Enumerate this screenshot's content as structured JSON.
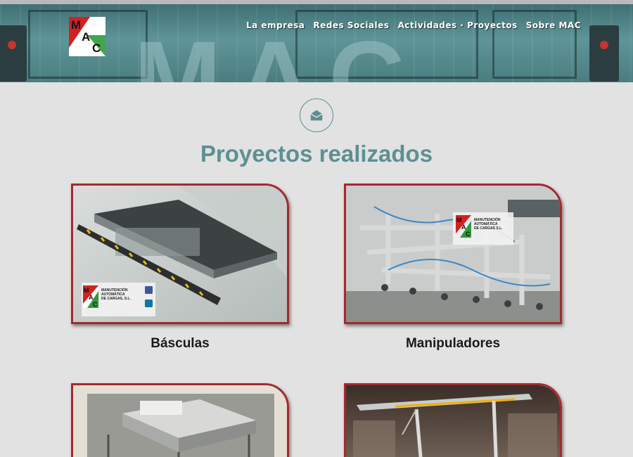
{
  "header": {
    "logo_letters": [
      "M",
      "A",
      "C"
    ],
    "background_text": "MAC",
    "nav": [
      {
        "label": "La empresa"
      },
      {
        "label": "Redes Sociales"
      },
      {
        "label": "Actividades · Proyectos"
      },
      {
        "label": "Sobre MAC"
      }
    ]
  },
  "section": {
    "icon": "envelope-open-icon",
    "title": "Proyectos realizados"
  },
  "projects": [
    {
      "label": "Básculas",
      "image": "platform-scale-photo",
      "logo_text": [
        "MANUTENCIÓN",
        "AUTOMÁTICA",
        "DE CARGAS, S.L."
      ]
    },
    {
      "label": "Manipuladores",
      "image": "vacuum-manipulator-photo",
      "logo_text": [
        "MANUTENCIÓN",
        "AUTOMÁTICA",
        "DE CARGAS S.L."
      ]
    },
    {
      "label": "",
      "image": "machine-table-photo"
    },
    {
      "label": "",
      "image": "overhead-crane-photo"
    }
  ],
  "colors": {
    "accent": "#5d9093",
    "card_border": "#a32a2f",
    "background": "#e2e2e2"
  }
}
